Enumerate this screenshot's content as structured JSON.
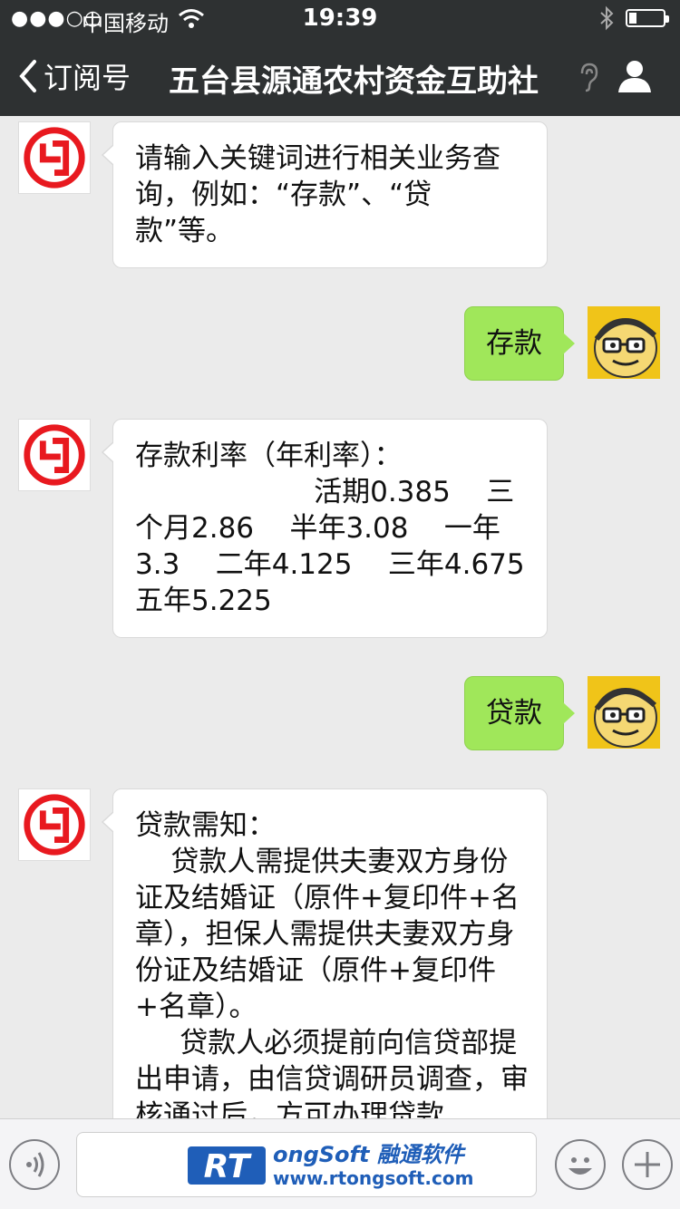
{
  "status_bar": {
    "signal": "●●●○○",
    "carrier": "中国移动",
    "time": "19:39"
  },
  "nav": {
    "back_label": "订阅号",
    "title": "五台县源通农村资金互助社"
  },
  "messages": [
    {
      "from": "bank",
      "text": "请输入关键词进行相关业务查询，例如：“存款”、“贷款”等。"
    },
    {
      "from": "user",
      "text": "存款"
    },
    {
      "from": "bank",
      "text": "存款利率（年利率）：\n                    活期0.385    三个月2.86    半年3.08    一年3.3    二年4.125    三年4.675    五年5.225"
    },
    {
      "from": "user",
      "text": "贷款"
    },
    {
      "from": "bank",
      "text": "贷款需知：\n    贷款人需提供夫妻双方身份证及结婚证（原件+复印件+名章），担保人需提供夫妻双方身份证及结婚证（原件+复印件+名章）。\n     贷款人必须提前向信贷部提出申请，由信贷调研员调查，审核通过后，方可办理贷款"
    }
  ],
  "watermark": {
    "logo": "RT",
    "line1": "ongSoft 融通软件",
    "line2": "www.rtongsoft.com"
  },
  "colors": {
    "bar_dark": "#2e3132",
    "chat_bg": "#ebebeb",
    "bubble_user": "#a0e75a",
    "bank_red": "#e8191f"
  }
}
